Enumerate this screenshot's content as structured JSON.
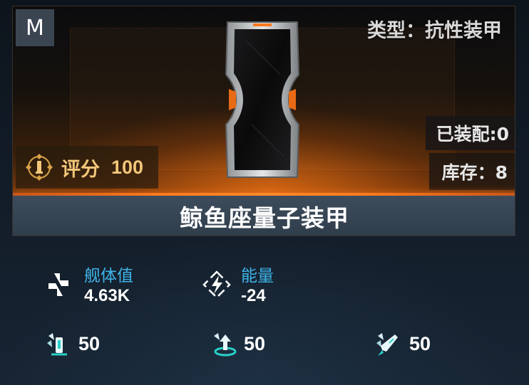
{
  "item": {
    "grade": "M",
    "type_label": "类型：抗性装甲",
    "equipped": "已装配:0",
    "stock": "库存：8",
    "score_label": "评分",
    "score_value": "100",
    "name": "鲸鱼座量子装甲",
    "image_icon": "hourglass-shaped-armor-plate",
    "colors": {
      "accent_orange": "#ff7a1e",
      "label_blue": "#3fb4ea",
      "score_gold": "#f3c77a"
    }
  },
  "stats": [
    {
      "icon": "hull-plus-icon",
      "label": "舰体值",
      "value": "4.63K"
    },
    {
      "icon": "energy-bolt-icon",
      "label": "能量",
      "value": "-24"
    }
  ],
  "resistances": [
    {
      "icon": "shield-resist-icon",
      "value": "50"
    },
    {
      "icon": "emitter-resist-icon",
      "value": "50"
    },
    {
      "icon": "missile-resist-icon",
      "value": "50"
    }
  ]
}
